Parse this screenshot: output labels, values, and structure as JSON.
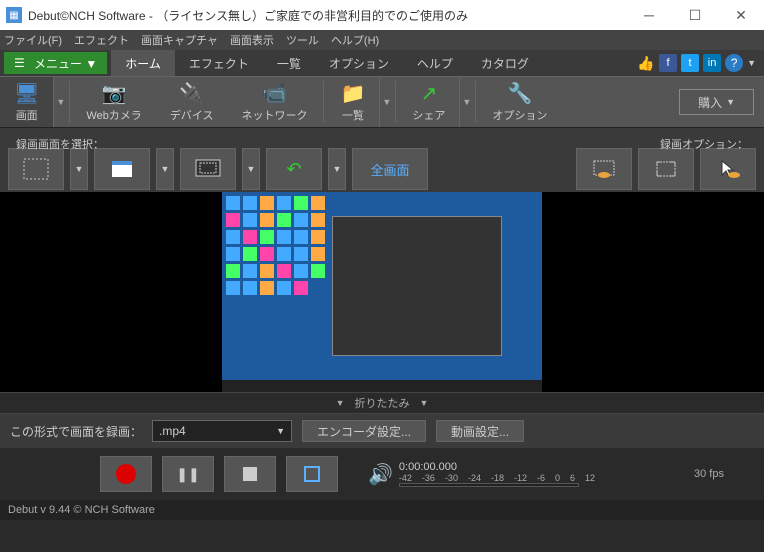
{
  "window": {
    "title": "Debut©NCH Software - （ライセンス無し）ご家庭での非営利目的でのご使用のみ"
  },
  "menubar": {
    "file": "ファイル(F)",
    "effects": "エフェクト",
    "screen_capture": "画面キャプチャ",
    "screen_display": "画面表示",
    "tools": "ツール",
    "help": "ヘルプ(H)"
  },
  "menu_button": "メニュー ▼",
  "tabs": {
    "home": "ホーム",
    "effects": "エフェクト",
    "list": "一覧",
    "options": "オプション",
    "help": "ヘルプ",
    "catalog": "カタログ"
  },
  "toolbar": {
    "screen": "画面",
    "webcam": "Webカメラ",
    "device": "デバイス",
    "network": "ネットワーク",
    "list": "一覧",
    "share": "シェア",
    "options": "オプション",
    "buy": "購入"
  },
  "optrow": {
    "select_label": "録画画面を選択：",
    "fullscreen": "全画面",
    "options_label": "録画オプション："
  },
  "collapse": {
    "label": "折りたたみ"
  },
  "settings": {
    "format_label": "この形式で画面を録画：",
    "format_value": ".mp4",
    "encoder_btn": "エンコーダ設定...",
    "video_btn": "動画設定..."
  },
  "controls": {
    "time": "0:00:00.000",
    "ticks": [
      "-42",
      "-36",
      "-30",
      "-24",
      "-18",
      "-12",
      "-6",
      "0",
      "6",
      "12"
    ],
    "fps": "30 fps"
  },
  "status": {
    "text": "Debut v 9.44 © NCH Software"
  }
}
